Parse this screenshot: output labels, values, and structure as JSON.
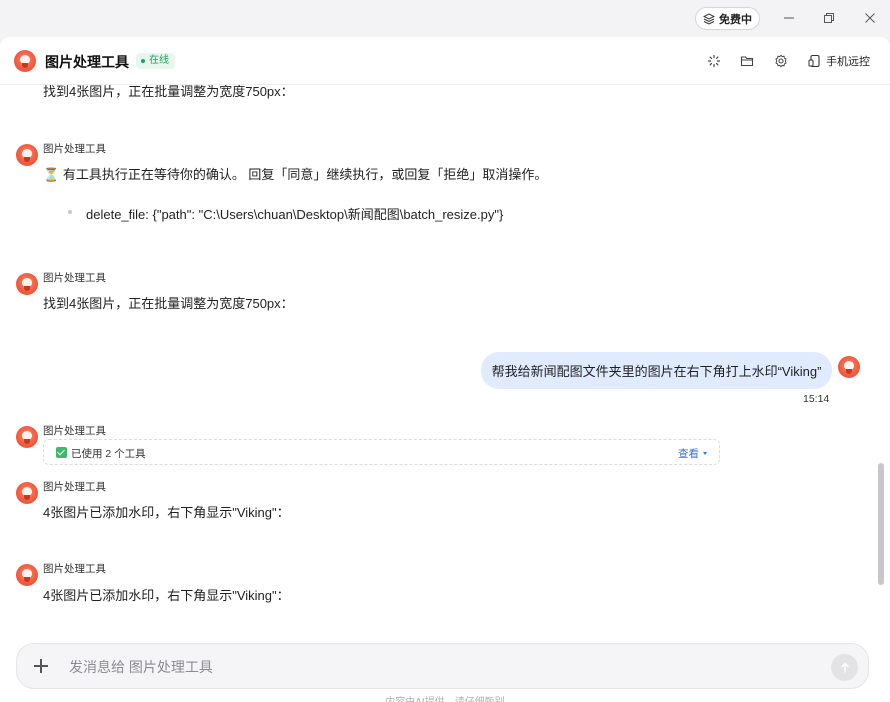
{
  "titlebar": {
    "plan_badge": "免费中",
    "plan_icon": "layers-icon",
    "window_controls": [
      "minimize-icon",
      "restore-icon",
      "close-icon"
    ]
  },
  "header": {
    "app_title": "图片处理工具",
    "status": "在线",
    "status_color": "#21a35a",
    "actions": [
      "loading-spinner-icon",
      "folder-icon",
      "gear-icon"
    ],
    "remote_label": "手机远控"
  },
  "messages": {
    "m0": {
      "text": "找到4张图片，正在批量调整为宽度750px："
    },
    "m1": {
      "sender": "图片处理工具",
      "icon": "⏳",
      "text": "有工具执行正在等待你的确认。 回复「同意」继续执行，或回复「拒绝」取消操作。",
      "bullet": "delete_file: {\"path\": \"C:\\Users\\chuan\\Desktop\\新闻配图\\batch_resize.py\"}"
    },
    "m2": {
      "sender": "图片处理工具",
      "text": "找到4张图片，正在批量调整为宽度750px："
    },
    "user": {
      "text": "帮我给新闻配图文件夹里的图片在右下角打上水印“Viking”",
      "time": "15:14"
    },
    "m3": {
      "sender": "图片处理工具",
      "tool_summary": "已使用 2 个工具",
      "tool_view": "查看"
    },
    "m4": {
      "sender": "图片处理工具",
      "text": "4张图片已添加水印，右下角显示\"Viking\"："
    },
    "m5": {
      "sender": "图片处理工具",
      "text": "4张图片已添加水印，右下角显示\"Viking\"："
    }
  },
  "composer": {
    "placeholder": "发消息给 图片处理工具",
    "value": ""
  },
  "footer": {
    "text": "内容由AI提供，请仔细甄别"
  },
  "colors": {
    "accent": "#3b6fe0",
    "user_bubble": "#e1ebff",
    "check": "#3fb86b"
  }
}
